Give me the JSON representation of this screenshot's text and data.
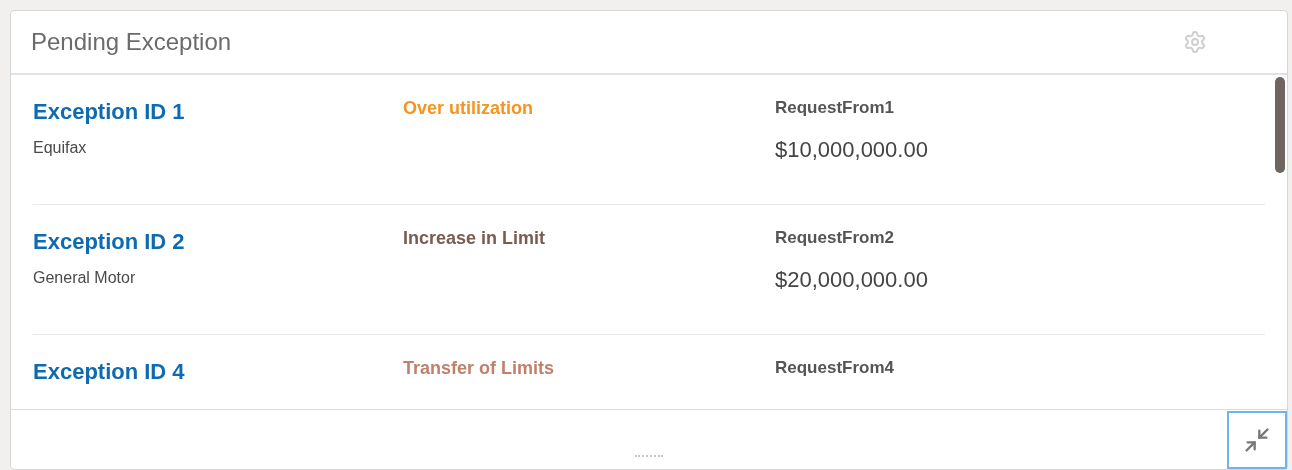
{
  "panel": {
    "title": "Pending Exception"
  },
  "exceptions": [
    {
      "id": "Exception ID 1",
      "company": "Equifax",
      "type": "Over utilization",
      "color": "#f7931e",
      "requester": "RequestFrom1",
      "amount": "$10,000,000.00"
    },
    {
      "id": "Exception ID 2",
      "company": "General Motor",
      "type": "Increase in Limit",
      "color": "#7a5c4f",
      "requester": "RequestFrom2",
      "amount": "$20,000,000.00"
    },
    {
      "id": "Exception ID 4",
      "type": "Transfer of Limits",
      "color": "#c0806a",
      "requester": "RequestFrom4"
    }
  ]
}
